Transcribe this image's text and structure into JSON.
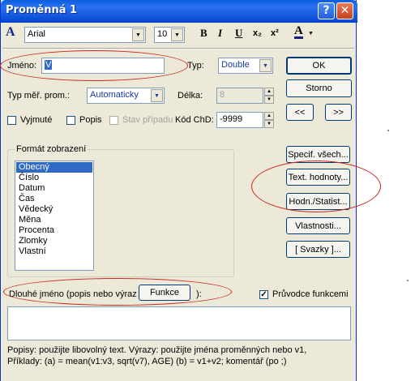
{
  "window": {
    "title": "Proměnná 1"
  },
  "titlebar": {
    "help_glyph": "?",
    "close_glyph": "✕"
  },
  "toolbar": {
    "font_icon": "A",
    "font_name": "Arial",
    "font_size": "10",
    "bold": "B",
    "italic": "I",
    "underline": "U",
    "subscript": "x₂",
    "superscript": "x²",
    "color_icon": "A"
  },
  "fields": {
    "name_label": "Jméno:",
    "name_value": "V",
    "type_label": "Typ:",
    "type_value": "Double",
    "measure_label": "Typ měř. prom.:",
    "measure_value": "Automaticky",
    "length_label": "Délka:",
    "length_value": "8",
    "md_code_label": "Kód ChD:",
    "md_code_value": "-9999"
  },
  "checkboxes": {
    "excluded": {
      "label": "Vyjmuté",
      "checked": false
    },
    "description": {
      "label": "Popis",
      "checked": false
    },
    "case_state": {
      "label": "Stav případu",
      "checked": false
    },
    "function_guide": {
      "label": "Průvodce funkcemi",
      "checked": true
    }
  },
  "buttons": {
    "ok": "OK",
    "cancel": "Storno",
    "prev": "<<",
    "next": ">>",
    "spec_all": "Specif. všech...",
    "text_values": "Text. hodnoty...",
    "values_stats": "Hodn./Statist...",
    "properties": "Vlastnosti...",
    "links": "[ Svazky ]...",
    "functions": "Funkce"
  },
  "format": {
    "group_label": "Formát zobrazení",
    "items": [
      "Obecný",
      "Číslo",
      "Datum",
      "Čas",
      "Vědecký",
      "Měna",
      "Procenta",
      "Zlomky",
      "Vlastní"
    ],
    "selected": "Obecný"
  },
  "long_name": {
    "label": "Dlouhé jméno (popis nebo výraz",
    "label_close": "):",
    "value": ""
  },
  "help": {
    "line1": "Popisy: použijte libovolný text.  Výrazy: použijte jména proměnných nebo v1,",
    "line2": "Příklady:   (a) = mean(v1:v3, sqrt(v7), AGE)  (b) = v1+v2; komentář (po ;)"
  }
}
